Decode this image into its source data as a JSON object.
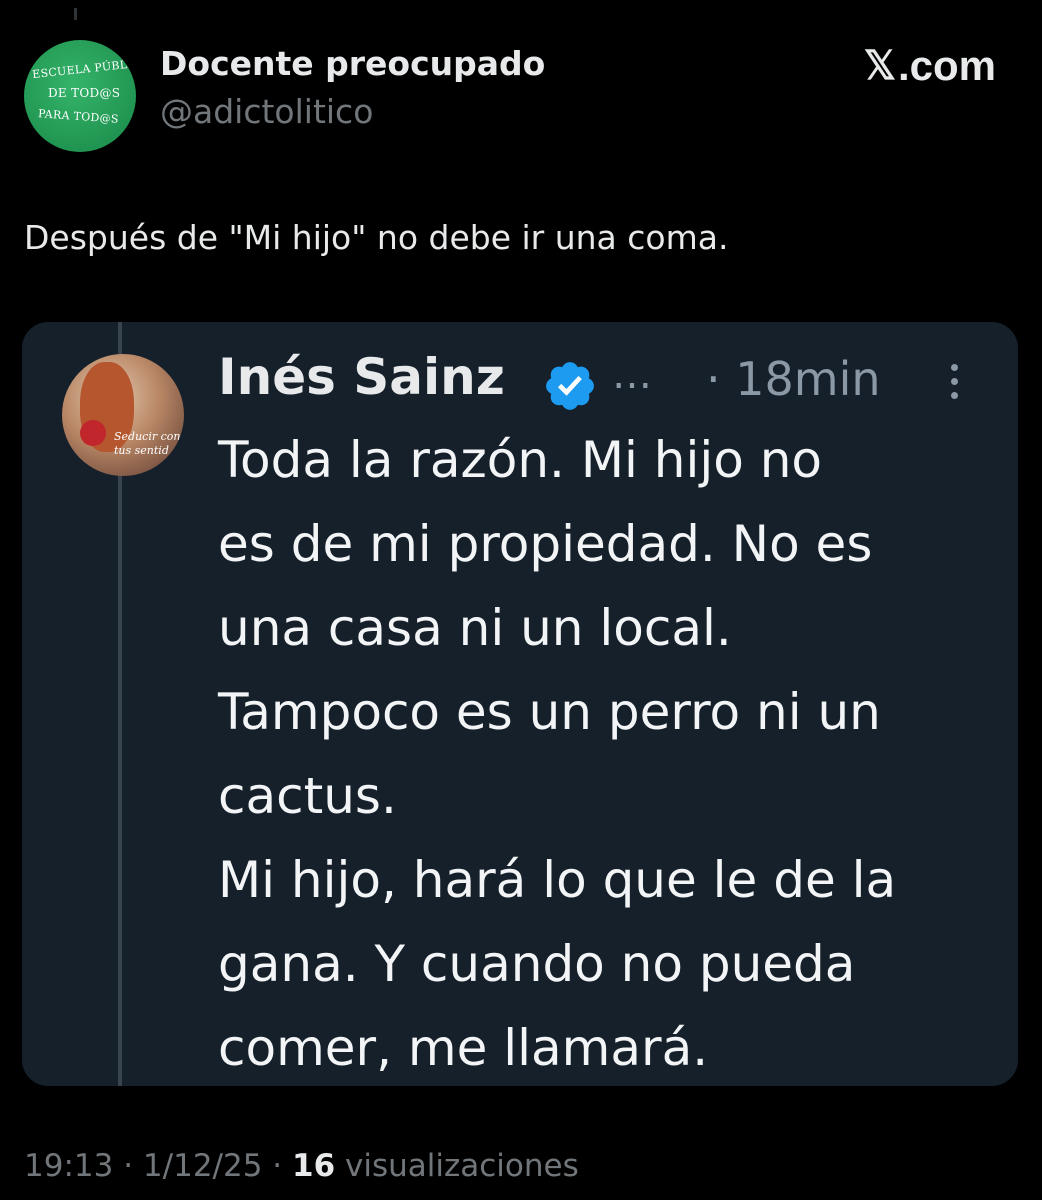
{
  "author": {
    "name": "Docente preocupado",
    "handle": "@adictolitico",
    "avatar_lines": [
      "ESCUELA PÚBLICA",
      "DE TOD@S",
      "PARA TOD@S"
    ]
  },
  "brand": {
    "label": ".com",
    "icon": "x-logo-icon"
  },
  "tweet_text": "Después de \"Mi hijo\" no debe ir una coma.",
  "quoted": {
    "name": "Inés Sainz",
    "ellipsis": "…",
    "time": "· 18min",
    "avatar_text": [
      "Seducir con",
      "tus sentid"
    ],
    "body": [
      "Toda la razón. Mi hijo no",
      "es de mi propiedad. No es",
      "una casa ni un local.",
      "Tampoco es un perro ni un",
      "cactus.",
      "Mi hijo, hará lo que le de la",
      "gana. Y cuando no pueda",
      "comer, me llamará."
    ]
  },
  "footer": {
    "time": "19:13",
    "date": "1/12/25",
    "views_count": "16",
    "views_label": "visualizaciones"
  },
  "colors": {
    "background": "#000000",
    "card": "#15202b",
    "verified": "#1d9bf0",
    "muted": "#71767b"
  }
}
